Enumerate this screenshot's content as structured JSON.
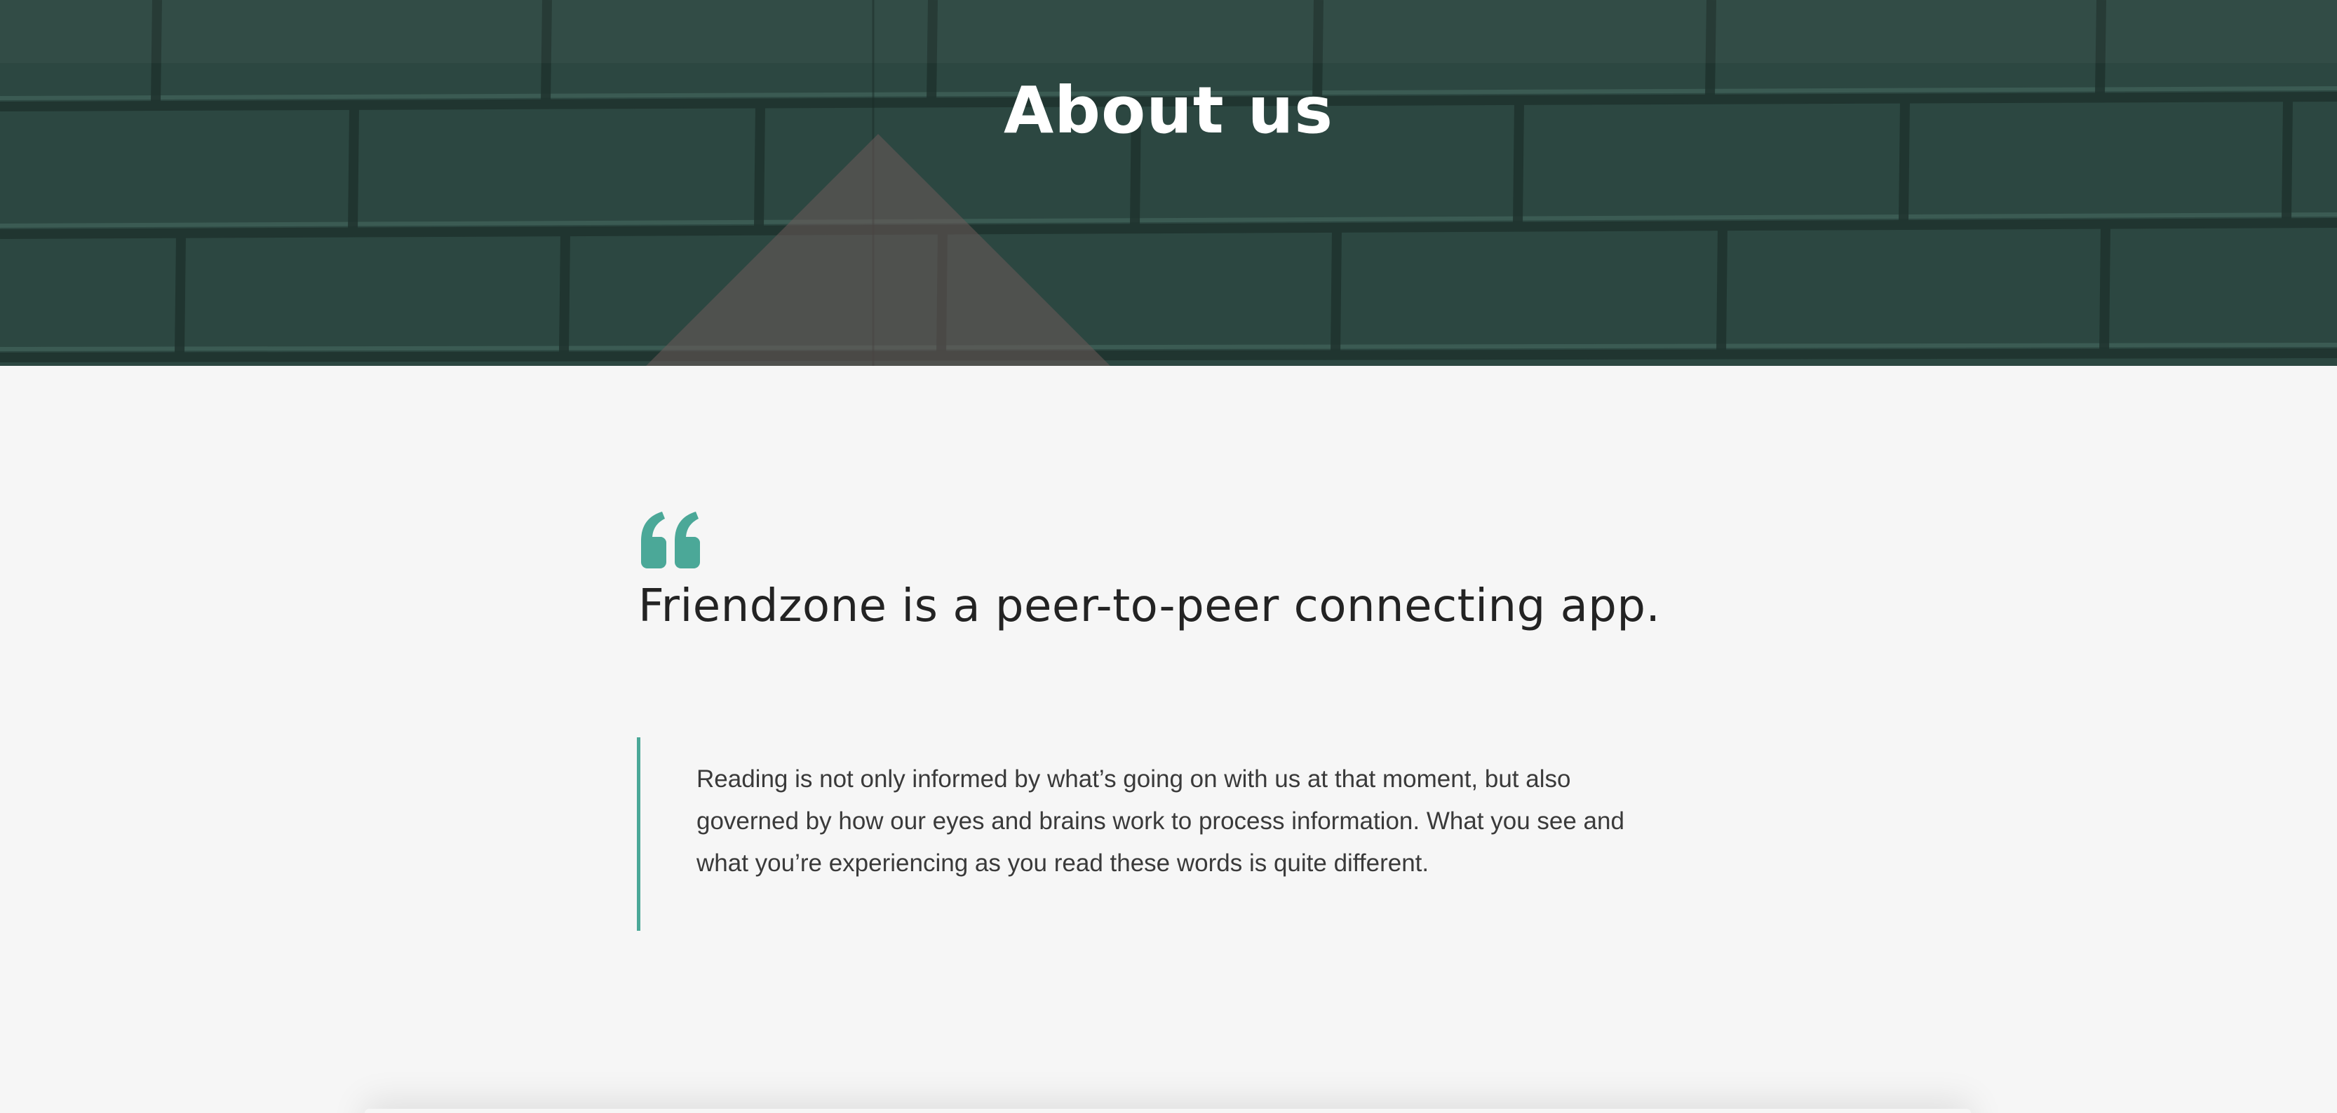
{
  "hero": {
    "title": "About us",
    "background_color": "#2b4640"
  },
  "content": {
    "quote_icon": "quote-open-icon",
    "headline": "Friendzone is a peer-to-peer connecting app.",
    "blockquote": "Reading is not only informed by what’s going on with us at that moment, but also governed by how our eyes and brains work to process information. What you see and what you’re experiencing as you read these words is quite different."
  },
  "colors": {
    "accent": "#4ba898",
    "page_background": "#f6f6f6",
    "heading_text": "#232323",
    "body_text": "#3a3a3a"
  }
}
